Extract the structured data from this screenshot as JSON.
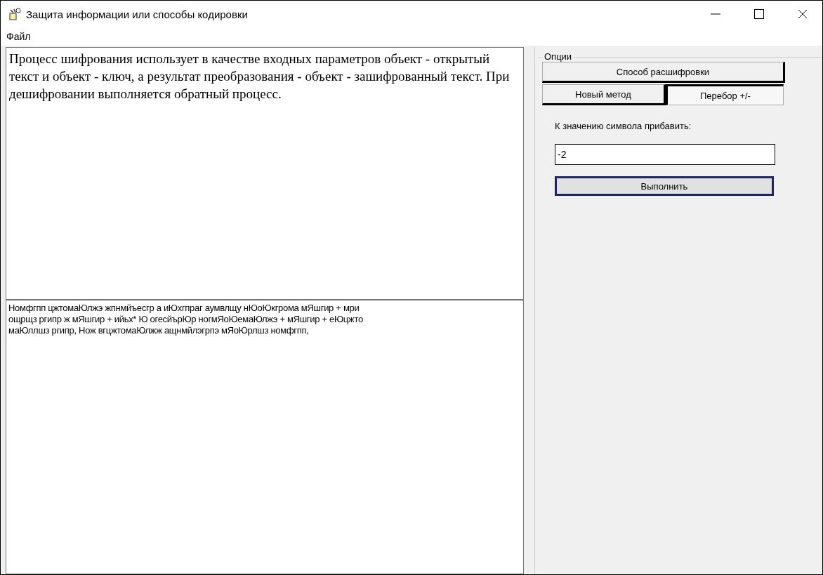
{
  "window": {
    "title": "Защита информации или способы кодировки"
  },
  "menu": [
    "Файл"
  ],
  "plain_text": "Процесс шифрования использует в качестве входных параметров объект - открытый текст и объект - ключ, а результат преобразования - объект - зашифрованный текст. При дешифровании выполняется обратный процесс.",
  "encoded_lines": [
    "Номфгпп цжтомаЮлжэ жпнмйъесгр а иЮхгпраг аумвлщу нЮоЮкгрома мЯшгир + мри",
    "ощрщз ргипр ж мЯшгир + ийьх* Ю огесйърЮр ногмЯоЮемаЮлжэ + мЯшгир + еЮцжто",
    "маЮллшз ргипр, Нож вгцжтомаЮлжж ащнмйлэгрпэ мЯоЮрлшз номфгпп,"
  ],
  "options": {
    "title": "Опции",
    "mode_button": "Способ расшифровки",
    "tabs": [
      {
        "label": "Новый метод",
        "selected": false
      },
      {
        "label": "Перебор +/-",
        "selected": true
      }
    ],
    "shift_label": "К значению символа прибавить:",
    "shift_value": "-2",
    "run_button": "Выполнить"
  }
}
